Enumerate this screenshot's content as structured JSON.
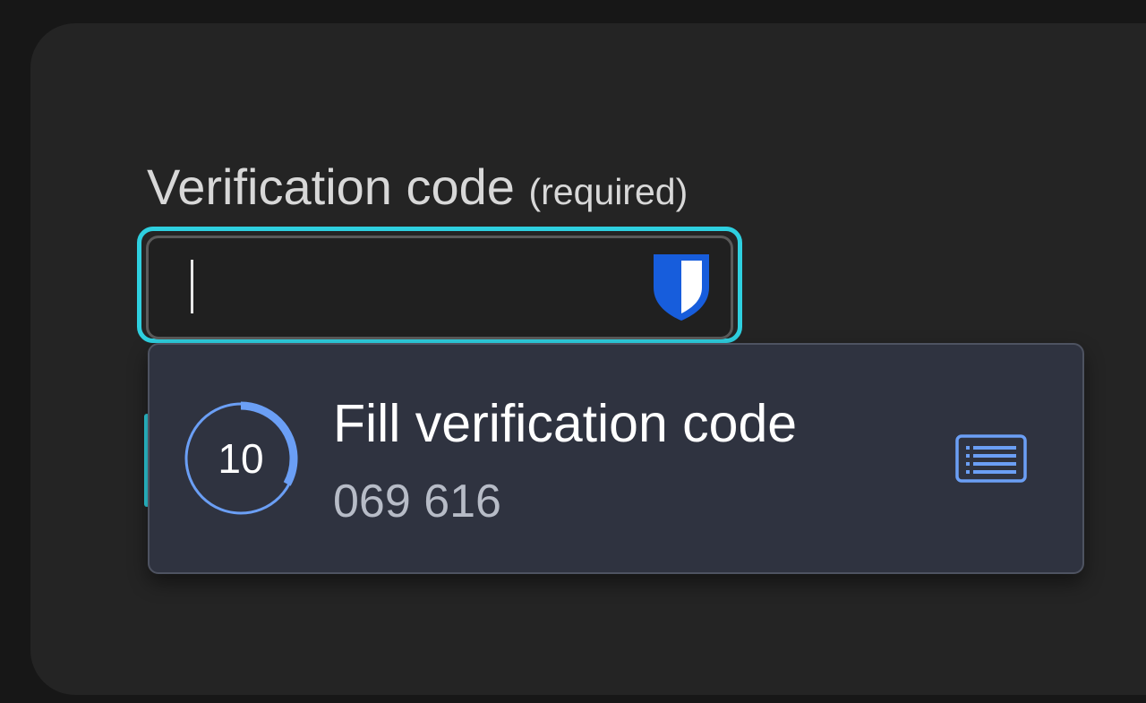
{
  "field": {
    "label": "Verification code",
    "required_note": "(required)",
    "value": ""
  },
  "autofill": {
    "brand_icon": "bitwarden-shield-icon",
    "suggestion": {
      "title": "Fill verification code",
      "code": "069 616",
      "timer_seconds": "10",
      "timer_progress_fraction": 0.33
    },
    "menu_icon": "list-icon"
  },
  "colors": {
    "focus_ring": "#2ed0e0",
    "accent_blue": "#6b9ff5",
    "shield_blue": "#175ddc"
  }
}
